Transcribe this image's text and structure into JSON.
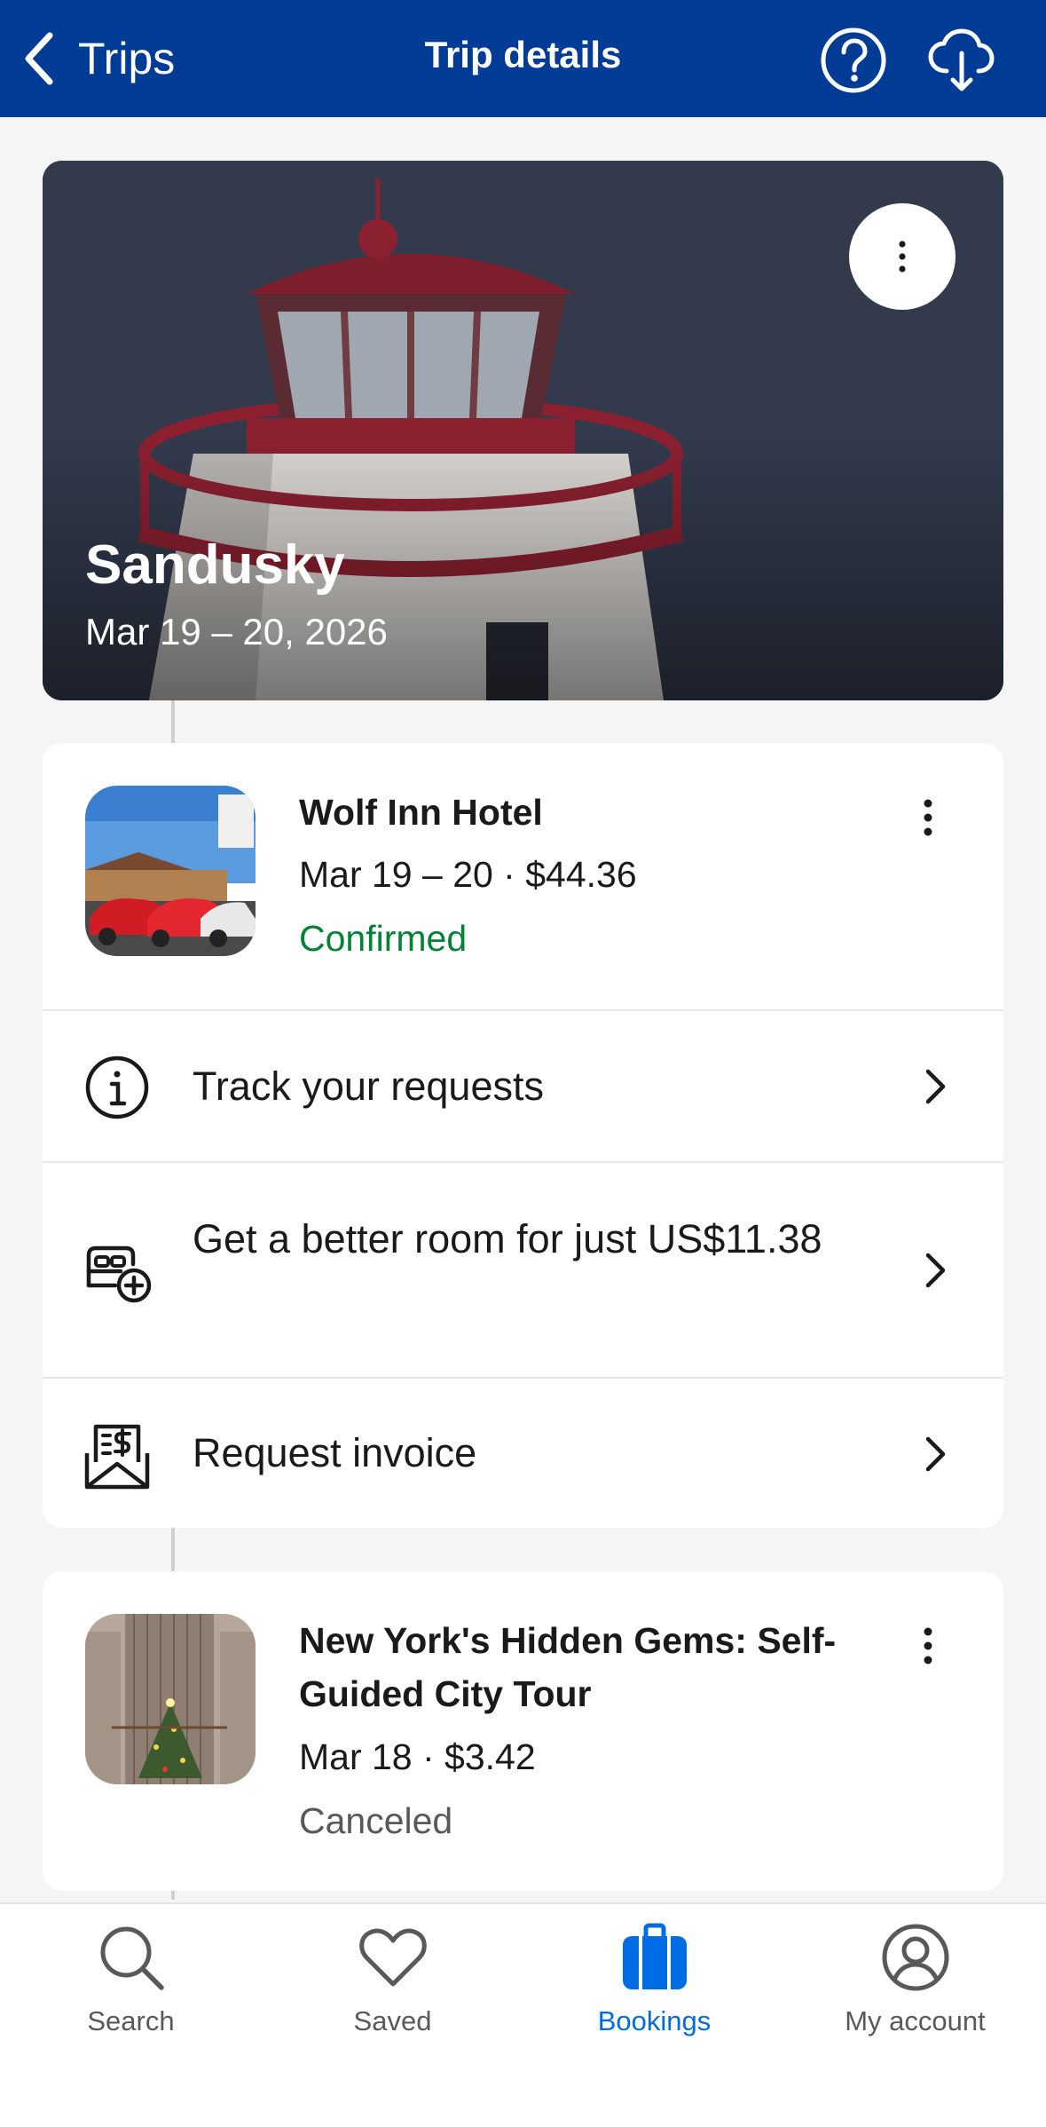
{
  "header": {
    "back_label": "Trips",
    "title": "Trip details",
    "icons": [
      "chevron-left-icon",
      "help-icon",
      "cloud-download-icon"
    ],
    "bg_color": "#003b95"
  },
  "hero": {
    "title": "Sandusky",
    "dates": "Mar 19 – 20, 2026"
  },
  "hotel": {
    "name": "Wolf Inn Hotel",
    "meta": "Mar 19 – 20 · $44.36",
    "status": "Confirmed",
    "status_color": "#008234",
    "actions": [
      {
        "label": "Track your requests",
        "icon": "info-icon"
      },
      {
        "label": "Get a better room for just US$11.38",
        "icon": "bed-add-icon"
      },
      {
        "label": "Request invoice",
        "icon": "invoice-icon"
      }
    ]
  },
  "tour": {
    "name": "New York's Hidden Gems: Self-Guided City Tour",
    "meta": "Mar 18 · $3.42",
    "status": "Canceled",
    "status_color": "#595959"
  },
  "bottom_nav": {
    "active": "Bookings",
    "active_color": "#006ce4",
    "items": [
      {
        "label": "Search",
        "icon": "search-icon"
      },
      {
        "label": "Saved",
        "icon": "heart-icon"
      },
      {
        "label": "Bookings",
        "icon": "suitcase-icon"
      },
      {
        "label": "My account",
        "icon": "account-icon"
      }
    ]
  }
}
